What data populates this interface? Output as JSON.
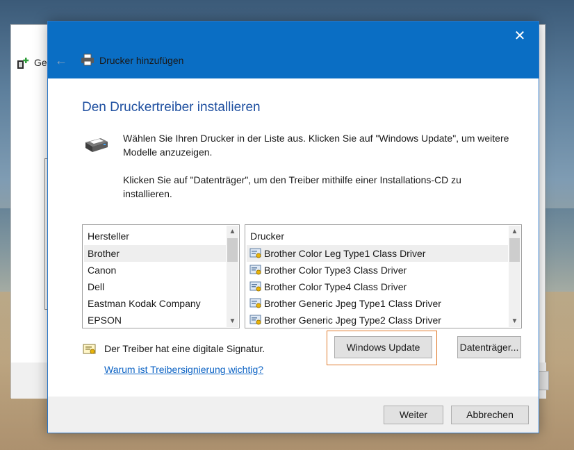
{
  "background_window": {
    "title_fragment": "Ge",
    "close_glyph": "✕"
  },
  "dialog": {
    "title": "Drucker hinzufügen",
    "close_glyph": "✕",
    "back_glyph": "←",
    "heading": "Den Druckertreiber installieren",
    "paragraph1": "Wählen Sie Ihren Drucker in der Liste aus. Klicken Sie auf \"Windows Update\", um weitere Modelle anzuzeigen.",
    "paragraph2": "Klicken Sie auf \"Datenträger\", um den Treiber mithilfe einer Installations-CD zu installieren."
  },
  "manufacturers": {
    "header": "Hersteller",
    "selected_index": 0,
    "items": [
      "Brother",
      "Canon",
      "Dell",
      "Eastman Kodak Company",
      "EPSON"
    ]
  },
  "printers": {
    "header": "Drucker",
    "selected_index": 0,
    "items": [
      "Brother Color Leg Type1 Class Driver",
      "Brother Color Type3 Class Driver",
      "Brother Color Type4 Class Driver",
      "Brother Generic Jpeg Type1 Class Driver",
      "Brother Generic Jpeg Type2 Class Driver"
    ]
  },
  "signature": {
    "text": "Der Treiber hat eine digitale Signatur.",
    "link": "Warum ist Treibersignierung wichtig?"
  },
  "buttons": {
    "windows_update": "Windows Update",
    "disk": "Datenträger...",
    "next": "Weiter",
    "cancel": "Abbrechen"
  },
  "scroll": {
    "up": "▲",
    "down": "▼"
  },
  "colors": {
    "titlebar": "#0a6ec4",
    "heading": "#1e4fa0",
    "link": "#0b62c4",
    "focus": "#e07a2c"
  }
}
